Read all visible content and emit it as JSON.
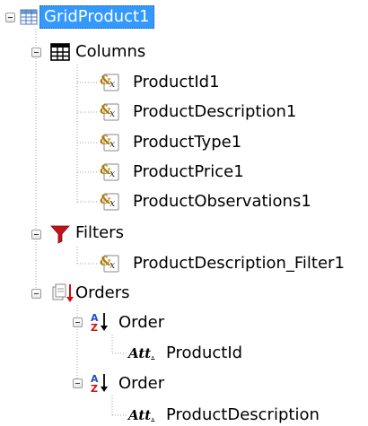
{
  "tree": {
    "root": {
      "label": "GridProduct1",
      "selected": true
    },
    "columns": {
      "label": "Columns",
      "items": [
        "ProductId1",
        "ProductDescription1",
        "ProductType1",
        "ProductPrice1",
        "ProductObservations1"
      ]
    },
    "filters": {
      "label": "Filters",
      "items": [
        "ProductDescription_Filter1"
      ]
    },
    "orders": {
      "label": "Orders",
      "items": [
        {
          "label": "Order",
          "attribute": "ProductId"
        },
        {
          "label": "Order",
          "attribute": "ProductDescription"
        }
      ]
    }
  },
  "icons": {
    "root": "grid-icon",
    "columns": "table-columns-icon",
    "column_item": "variable-icon",
    "filters": "funnel-icon",
    "orders": "orders-icon",
    "order": "sort-az-icon",
    "attribute": "attribute-icon"
  },
  "colors": {
    "selection": "#3399ff",
    "funnel": "#c0141c",
    "sort_arrow": "#d01010",
    "sort_letters": "#1f4fc8"
  }
}
